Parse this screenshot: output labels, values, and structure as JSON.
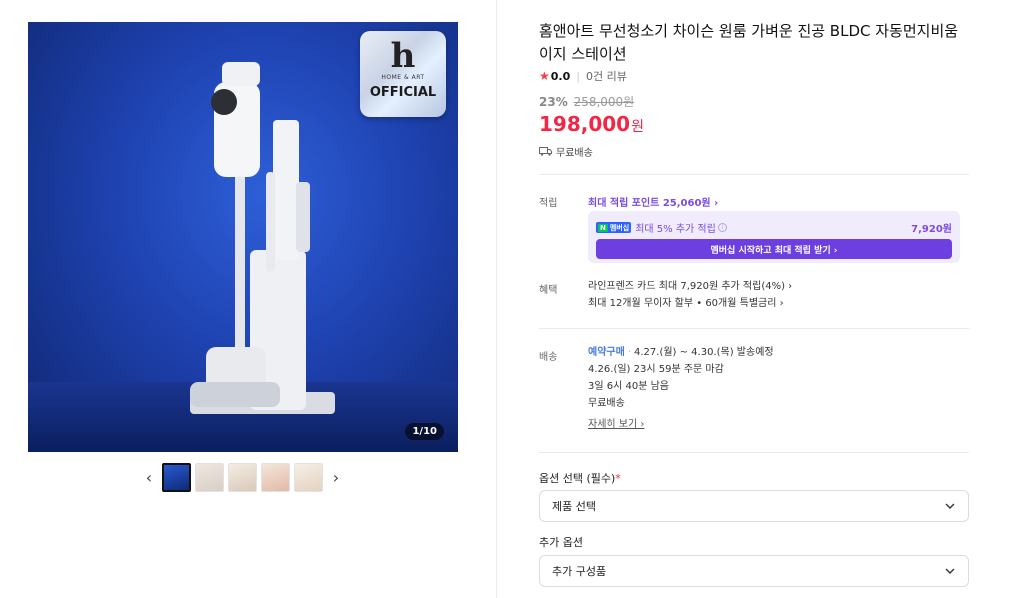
{
  "gallery": {
    "badge_logo": "h",
    "badge_brand": "HOME & ART",
    "badge_official": "OFFICIAL",
    "counter": "1/10",
    "prev_icon": "‹",
    "next_icon": "›",
    "thumb_count": 5
  },
  "product": {
    "title": "홈앤아트 무선청소기 차이슨 원룸 가벼운 진공 BLDC 자동먼지비움 이지 스테이션",
    "rating": "0.0",
    "reviews": "0건 리뷰",
    "discount_rate": "23%",
    "original_price": "258,000원",
    "price": "198,000",
    "price_unit": "원",
    "shipping_short": "무료배송"
  },
  "points": {
    "label": "적립",
    "max_points": "최대 적립 포인트 25,060원 ›",
    "npay_logo": "멤버십",
    "npay_text": "최대 5% 추가 적립",
    "npay_amount": "7,920원",
    "membership_button": "멤버십 시작하고 최대 적립 받기 ›"
  },
  "benefits": {
    "label": "혜택",
    "card": "라인프렌즈 카드 최대 7,920원 추가 적립(4%) ›",
    "installment": "최대 12개월 무이자 할부 • 60개월 특별금리 ›"
  },
  "delivery": {
    "label": "배송",
    "reserve": "예약구매",
    "schedule": "4.27.(월) ~ 4.30.(목) 발송예정",
    "deadline": "4.26.(일) 23시 59분 주문 마감",
    "remaining": "3일 6시 40분 남음",
    "free": "무료배송",
    "detail_link": "자세히 보기 ›"
  },
  "options": {
    "required_label": "옵션 선택 (필수)",
    "required_mark": "*",
    "product_select": "제품 선택",
    "extra_label": "추가 옵션",
    "extra_select": "추가 구성품"
  },
  "colors": {
    "price": "#f22745",
    "accent_purple": "#7b4ce0",
    "reserve_blue": "#4a7be0"
  }
}
